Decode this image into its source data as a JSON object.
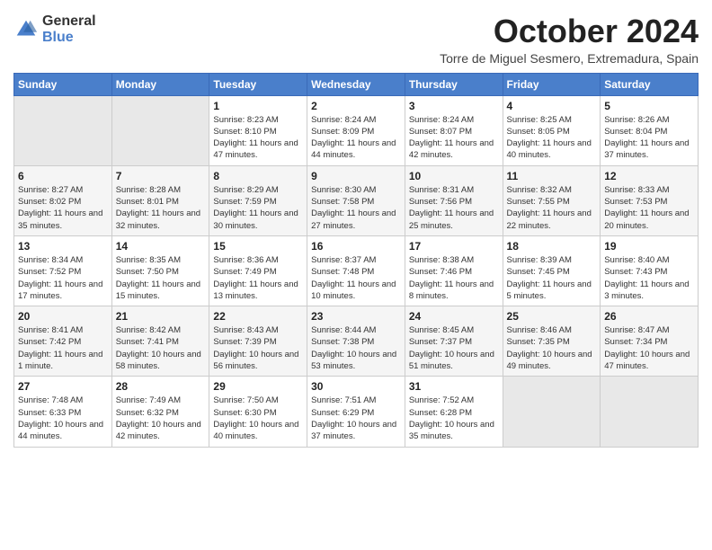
{
  "logo": {
    "general": "General",
    "blue": "Blue"
  },
  "title": "October 2024",
  "location": "Torre de Miguel Sesmero, Extremadura, Spain",
  "weekdays": [
    "Sunday",
    "Monday",
    "Tuesday",
    "Wednesday",
    "Thursday",
    "Friday",
    "Saturday"
  ],
  "weeks": [
    [
      {
        "day": "",
        "info": ""
      },
      {
        "day": "",
        "info": ""
      },
      {
        "day": "1",
        "info": "Sunrise: 8:23 AM\nSunset: 8:10 PM\nDaylight: 11 hours and 47 minutes."
      },
      {
        "day": "2",
        "info": "Sunrise: 8:24 AM\nSunset: 8:09 PM\nDaylight: 11 hours and 44 minutes."
      },
      {
        "day": "3",
        "info": "Sunrise: 8:24 AM\nSunset: 8:07 PM\nDaylight: 11 hours and 42 minutes."
      },
      {
        "day": "4",
        "info": "Sunrise: 8:25 AM\nSunset: 8:05 PM\nDaylight: 11 hours and 40 minutes."
      },
      {
        "day": "5",
        "info": "Sunrise: 8:26 AM\nSunset: 8:04 PM\nDaylight: 11 hours and 37 minutes."
      }
    ],
    [
      {
        "day": "6",
        "info": "Sunrise: 8:27 AM\nSunset: 8:02 PM\nDaylight: 11 hours and 35 minutes."
      },
      {
        "day": "7",
        "info": "Sunrise: 8:28 AM\nSunset: 8:01 PM\nDaylight: 11 hours and 32 minutes."
      },
      {
        "day": "8",
        "info": "Sunrise: 8:29 AM\nSunset: 7:59 PM\nDaylight: 11 hours and 30 minutes."
      },
      {
        "day": "9",
        "info": "Sunrise: 8:30 AM\nSunset: 7:58 PM\nDaylight: 11 hours and 27 minutes."
      },
      {
        "day": "10",
        "info": "Sunrise: 8:31 AM\nSunset: 7:56 PM\nDaylight: 11 hours and 25 minutes."
      },
      {
        "day": "11",
        "info": "Sunrise: 8:32 AM\nSunset: 7:55 PM\nDaylight: 11 hours and 22 minutes."
      },
      {
        "day": "12",
        "info": "Sunrise: 8:33 AM\nSunset: 7:53 PM\nDaylight: 11 hours and 20 minutes."
      }
    ],
    [
      {
        "day": "13",
        "info": "Sunrise: 8:34 AM\nSunset: 7:52 PM\nDaylight: 11 hours and 17 minutes."
      },
      {
        "day": "14",
        "info": "Sunrise: 8:35 AM\nSunset: 7:50 PM\nDaylight: 11 hours and 15 minutes."
      },
      {
        "day": "15",
        "info": "Sunrise: 8:36 AM\nSunset: 7:49 PM\nDaylight: 11 hours and 13 minutes."
      },
      {
        "day": "16",
        "info": "Sunrise: 8:37 AM\nSunset: 7:48 PM\nDaylight: 11 hours and 10 minutes."
      },
      {
        "day": "17",
        "info": "Sunrise: 8:38 AM\nSunset: 7:46 PM\nDaylight: 11 hours and 8 minutes."
      },
      {
        "day": "18",
        "info": "Sunrise: 8:39 AM\nSunset: 7:45 PM\nDaylight: 11 hours and 5 minutes."
      },
      {
        "day": "19",
        "info": "Sunrise: 8:40 AM\nSunset: 7:43 PM\nDaylight: 11 hours and 3 minutes."
      }
    ],
    [
      {
        "day": "20",
        "info": "Sunrise: 8:41 AM\nSunset: 7:42 PM\nDaylight: 11 hours and 1 minute."
      },
      {
        "day": "21",
        "info": "Sunrise: 8:42 AM\nSunset: 7:41 PM\nDaylight: 10 hours and 58 minutes."
      },
      {
        "day": "22",
        "info": "Sunrise: 8:43 AM\nSunset: 7:39 PM\nDaylight: 10 hours and 56 minutes."
      },
      {
        "day": "23",
        "info": "Sunrise: 8:44 AM\nSunset: 7:38 PM\nDaylight: 10 hours and 53 minutes."
      },
      {
        "day": "24",
        "info": "Sunrise: 8:45 AM\nSunset: 7:37 PM\nDaylight: 10 hours and 51 minutes."
      },
      {
        "day": "25",
        "info": "Sunrise: 8:46 AM\nSunset: 7:35 PM\nDaylight: 10 hours and 49 minutes."
      },
      {
        "day": "26",
        "info": "Sunrise: 8:47 AM\nSunset: 7:34 PM\nDaylight: 10 hours and 47 minutes."
      }
    ],
    [
      {
        "day": "27",
        "info": "Sunrise: 7:48 AM\nSunset: 6:33 PM\nDaylight: 10 hours and 44 minutes."
      },
      {
        "day": "28",
        "info": "Sunrise: 7:49 AM\nSunset: 6:32 PM\nDaylight: 10 hours and 42 minutes."
      },
      {
        "day": "29",
        "info": "Sunrise: 7:50 AM\nSunset: 6:30 PM\nDaylight: 10 hours and 40 minutes."
      },
      {
        "day": "30",
        "info": "Sunrise: 7:51 AM\nSunset: 6:29 PM\nDaylight: 10 hours and 37 minutes."
      },
      {
        "day": "31",
        "info": "Sunrise: 7:52 AM\nSunset: 6:28 PM\nDaylight: 10 hours and 35 minutes."
      },
      {
        "day": "",
        "info": ""
      },
      {
        "day": "",
        "info": ""
      }
    ]
  ]
}
